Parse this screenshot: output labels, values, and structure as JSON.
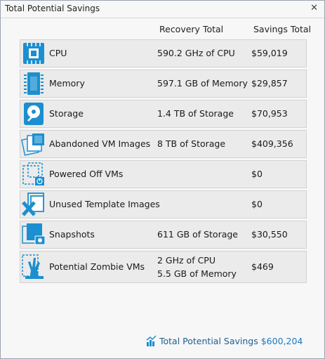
{
  "window": {
    "title": "Total Potential Savings"
  },
  "columns": {
    "recovery": "Recovery Total",
    "savings": "Savings Total"
  },
  "rows": [
    {
      "icon": "cpu-icon",
      "name": "CPU",
      "recovery": "590.2 GHz of CPU",
      "savings": "$59,019"
    },
    {
      "icon": "memory-icon",
      "name": "Memory",
      "recovery": "597.1 GB of Memory",
      "savings": "$29,857"
    },
    {
      "icon": "storage-icon",
      "name": "Storage",
      "recovery": "1.4 TB of Storage",
      "savings": "$70,953"
    },
    {
      "icon": "abandoned-vm-images-icon",
      "name": "Abandoned VM Images",
      "recovery": "8 TB of Storage",
      "savings": "$409,356"
    },
    {
      "icon": "powered-off-vm-icon",
      "name": "Powered Off VMs",
      "recovery": "",
      "savings": "$0"
    },
    {
      "icon": "unused-template-icon",
      "name": "Unused Template Images",
      "recovery": "",
      "savings": "$0"
    },
    {
      "icon": "snapshot-icon",
      "name": "Snapshots",
      "recovery": "611 GB of Storage",
      "savings": "$30,550"
    },
    {
      "icon": "zombie-icon",
      "name": "Potential Zombie VMs",
      "recovery": "2 GHz of CPU",
      "recovery2": "5.5 GB of Memory",
      "savings": "$469"
    }
  ],
  "total": {
    "icon": "chart-growth-icon",
    "label": "Total Potential Savings",
    "value": "$600,204"
  },
  "colors": {
    "accent": "#1a78c2",
    "icon_blue": "#1b8fcf",
    "row_bg": "#ebebeb"
  }
}
